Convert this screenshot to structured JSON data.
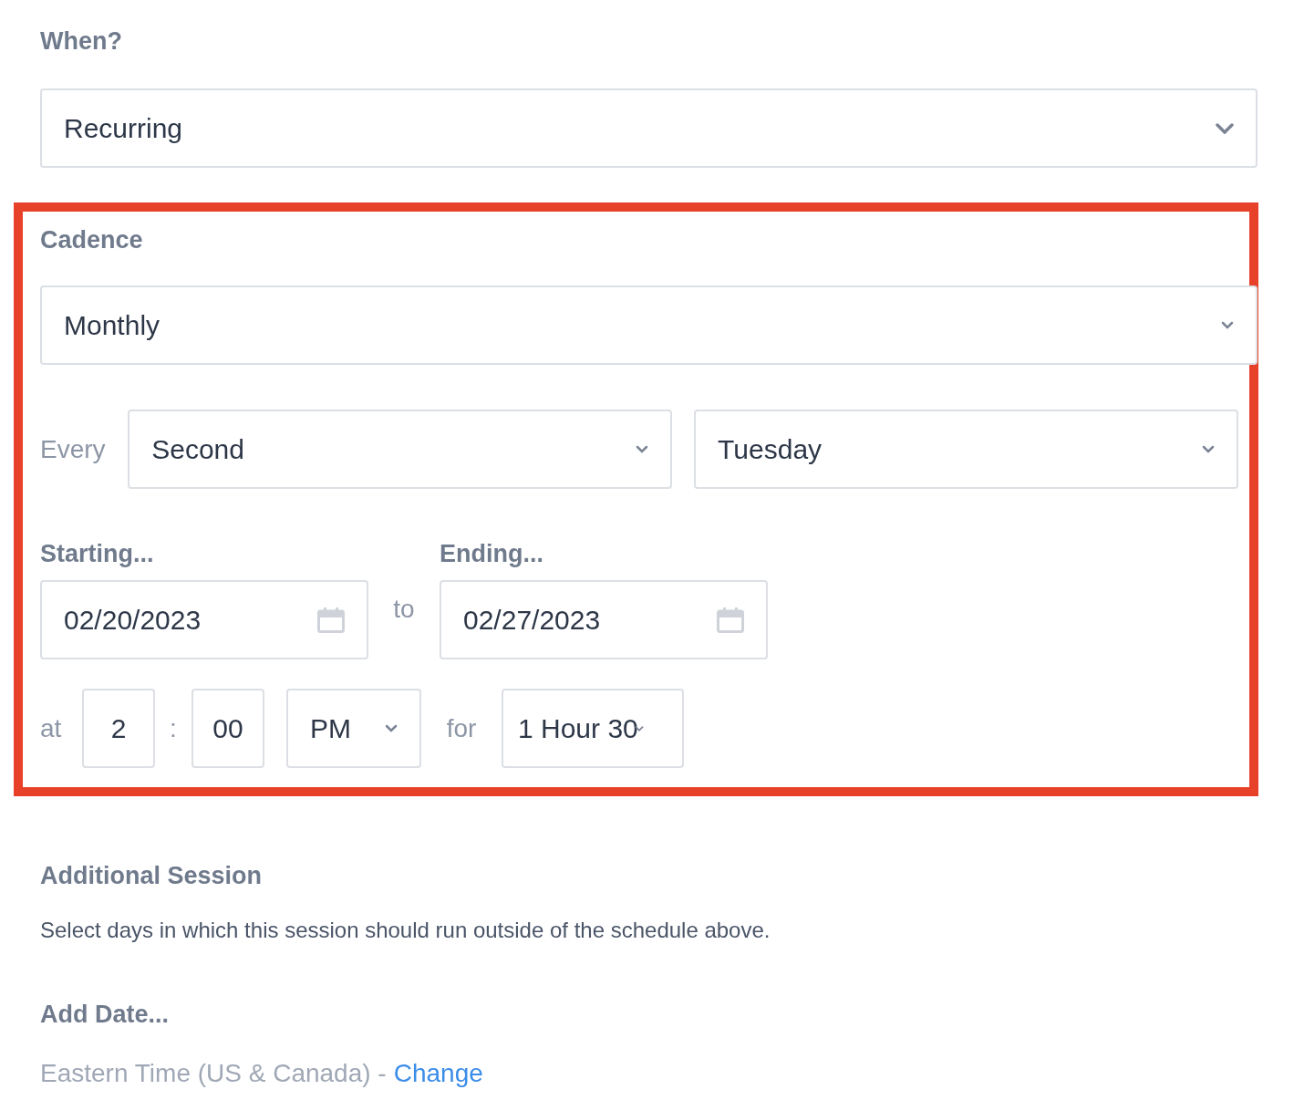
{
  "when": {
    "label": "When?",
    "value": "Recurring"
  },
  "cadence": {
    "label": "Cadence",
    "value": "Monthly"
  },
  "every": {
    "label": "Every",
    "ordinal": "Second",
    "weekday": "Tuesday"
  },
  "starting": {
    "label": "Starting...",
    "date": "02/20/2023"
  },
  "to": "to",
  "ending": {
    "label": "Ending...",
    "date": "02/27/2023"
  },
  "time": {
    "at": "at",
    "hour": "2",
    "separator": ":",
    "minute": "00",
    "meridiem": "PM",
    "for": "for",
    "duration": "1 Hour 30"
  },
  "additional": {
    "title": "Additional Session",
    "description": "Select days in which this session should run outside of the schedule above."
  },
  "add_date": "Add Date...",
  "timezone": {
    "text": "Eastern Time (US & Canada) -",
    "link": "Change"
  }
}
